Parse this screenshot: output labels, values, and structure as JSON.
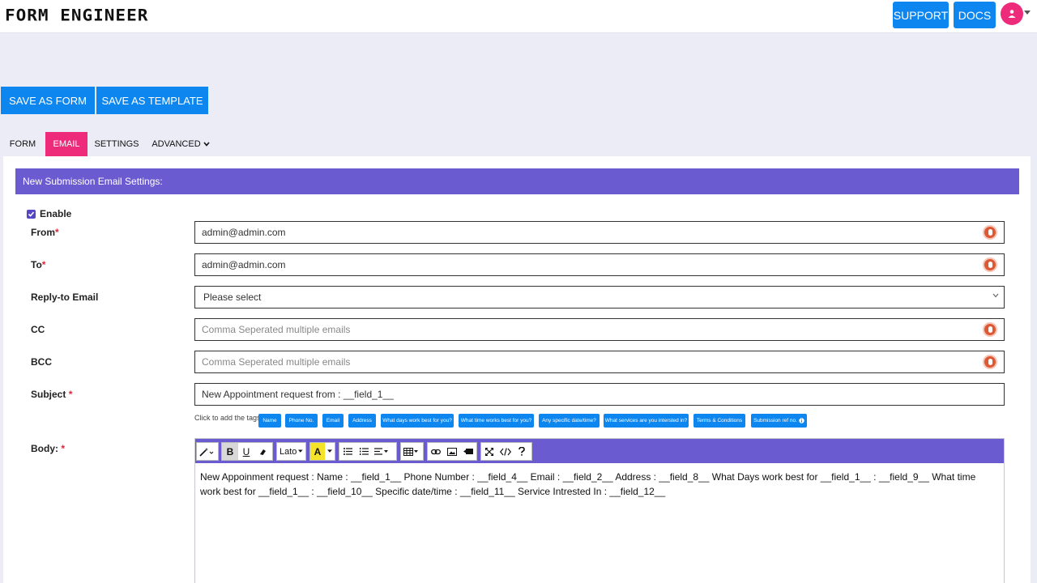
{
  "header": {
    "logo": "FORM ENGINEER",
    "support_label": "SUPPORT",
    "docs_label": "DOCS"
  },
  "actions": {
    "save_form_label": "SAVE AS FORM",
    "save_template_label": "SAVE AS TEMPLATE"
  },
  "tabs": [
    {
      "label": "FORM"
    },
    {
      "label": "EMAIL",
      "active": true
    },
    {
      "label": "SETTINGS"
    },
    {
      "label": "ADVANCED"
    }
  ],
  "panel": {
    "title": "New Submission Email Settings:",
    "enable_label": "Enable",
    "enabled": true
  },
  "fields": {
    "from": {
      "label": "From",
      "value": "admin@admin.com"
    },
    "to": {
      "label": "To",
      "value": "admin@admin.com"
    },
    "reply_to": {
      "label": "Reply-to Email",
      "value": "Please select"
    },
    "cc": {
      "label": "CC",
      "placeholder": "Comma Seperated multiple emails"
    },
    "bcc": {
      "label": "BCC",
      "placeholder": "Comma Seperated multiple emails"
    },
    "subject": {
      "label": "Subject",
      "value": "New Appointment request from : __field_1__"
    }
  },
  "tags": {
    "hint": "Click to add the tags:",
    "items": [
      "Name",
      "Phone No.",
      "Email",
      "Address",
      "What days work best for you?",
      "What time works best for you?",
      "Any specific date/time?",
      "What services are you intersted in?",
      "Terms & Conditions",
      "Submission ref no."
    ]
  },
  "body": {
    "label": "Body:",
    "font_name": "Lato",
    "content": "New Appoinment request : Name : __field_1__ Phone Number : __field_4__ Email : __field_2__ Address : __field_8__ What Days work best for __field_1__ : __field_9__ What time work best for __field_1__ : __field_10__ Specific date/time : __field_11__ Service Intrested In : __field_12__"
  },
  "colors": {
    "primary": "#0d86f0",
    "accent": "#ee2a7b",
    "panel_header": "#6b5bd1",
    "background": "#ebecf6"
  }
}
